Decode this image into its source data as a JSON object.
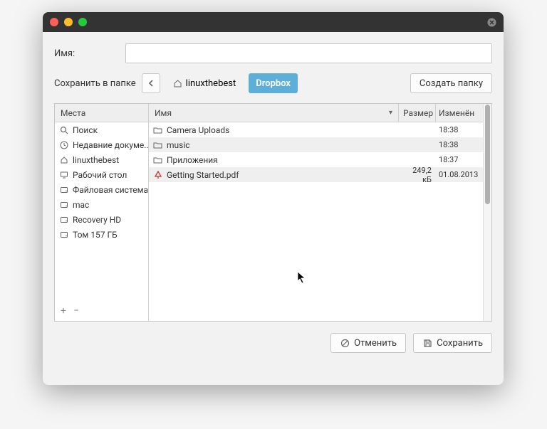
{
  "name_label": "Имя:",
  "name_value": "",
  "save_in_label": "Сохранить в папке",
  "path": {
    "parent": "linuxthebest",
    "current": "Dropbox"
  },
  "create_folder": "Создать папку",
  "sidebar": {
    "header": "Места",
    "items": [
      {
        "icon": "search",
        "label": "Поиск"
      },
      {
        "icon": "clock",
        "label": "Недавние докуме..."
      },
      {
        "icon": "home",
        "label": "linuxthebest"
      },
      {
        "icon": "desktop",
        "label": "Рабочий стол"
      },
      {
        "icon": "disk",
        "label": "Файловая система"
      },
      {
        "icon": "disk",
        "label": "mac"
      },
      {
        "icon": "disk",
        "label": "Recovery HD"
      },
      {
        "icon": "disk",
        "label": "Том 157 ГБ"
      }
    ]
  },
  "filelist": {
    "columns": {
      "name": "Имя",
      "size": "Размер",
      "modified": "Изменён"
    },
    "rows": [
      {
        "icon": "folder",
        "name": "Camera Uploads",
        "size": "",
        "modified": "18:38",
        "alt": false
      },
      {
        "icon": "folder",
        "name": "music",
        "size": "",
        "modified": "18:38",
        "alt": true
      },
      {
        "icon": "folder",
        "name": "Приложения",
        "size": "",
        "modified": "18:37",
        "alt": false
      },
      {
        "icon": "pdf",
        "name": "Getting Started.pdf",
        "size": "249,2 кБ",
        "modified": "01.08.2013",
        "alt": true
      }
    ]
  },
  "buttons": {
    "cancel": "Отменить",
    "save": "Сохранить"
  }
}
